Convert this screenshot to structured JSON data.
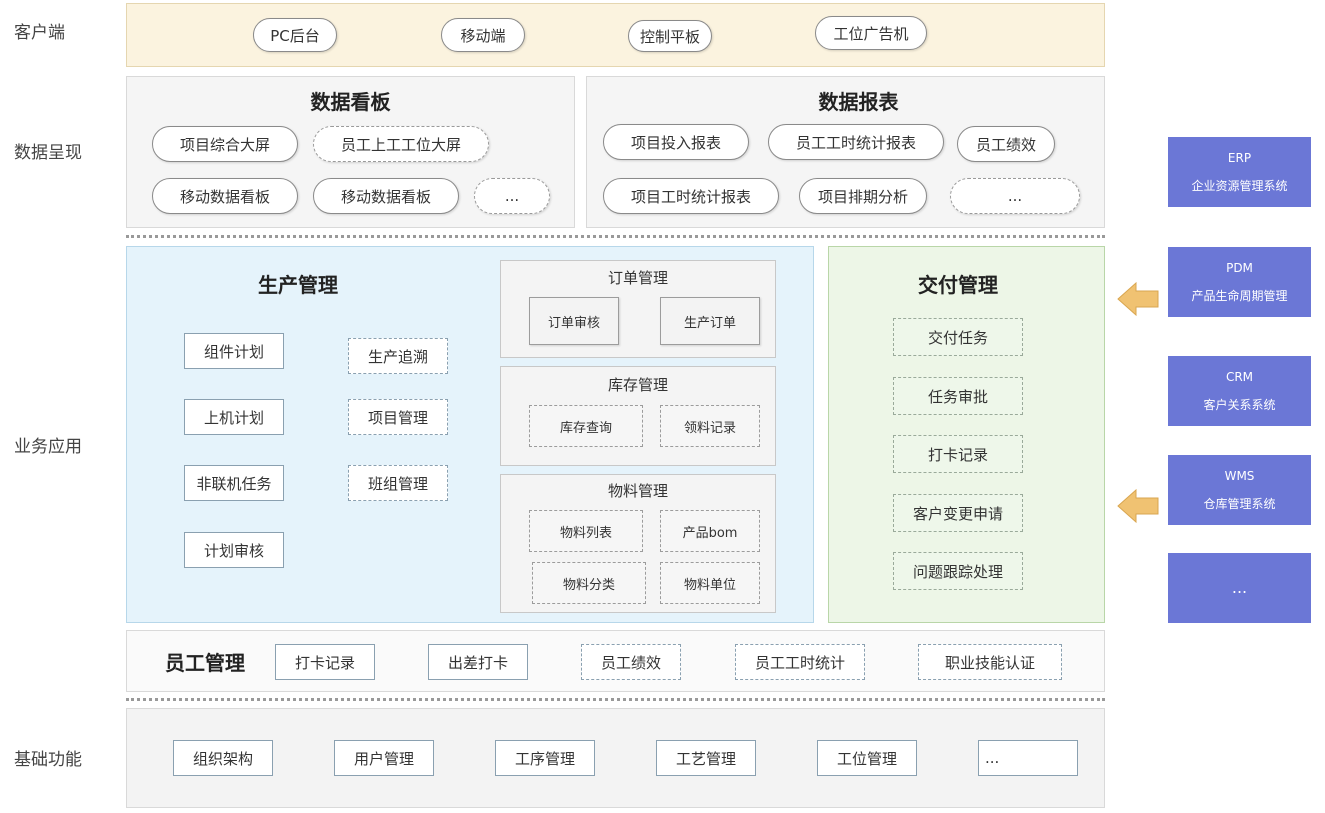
{
  "rows": {
    "client": "客户端",
    "data_display": "数据呈现",
    "business": "业务应用",
    "foundation": "基础功能"
  },
  "client_items": [
    "PC后台",
    "移动端",
    "控制平板",
    "工位广告机"
  ],
  "dashboard": {
    "title": "数据看板",
    "items": [
      "项目综合大屏",
      "员工上工工位大屏",
      "移动数据看板",
      "移动数据看板",
      "..."
    ]
  },
  "reports": {
    "title": "数据报表",
    "items": [
      "项目投入报表",
      "员工工时统计报表",
      "员工绩效",
      "项目工时统计报表",
      "项目排期分析",
      "..."
    ]
  },
  "production": {
    "title": "生产管理",
    "left": [
      "组件计划",
      "上机计划",
      "非联机任务",
      "计划审核"
    ],
    "right": [
      "生产追溯",
      "项目管理",
      "班组管理"
    ],
    "order": {
      "title": "订单管理",
      "items": [
        "订单审核",
        "生产订单"
      ]
    },
    "inventory": {
      "title": "库存管理",
      "items": [
        "库存查询",
        "领料记录"
      ]
    },
    "material": {
      "title": "物料管理",
      "items": [
        "物料列表",
        "产品bom",
        "物料分类",
        "物料单位"
      ]
    }
  },
  "delivery": {
    "title": "交付管理",
    "items": [
      "交付任务",
      "任务审批",
      "打卡记录",
      "客户变更申请",
      "问题跟踪处理"
    ]
  },
  "staff": {
    "title": "员工管理",
    "items": [
      "打卡记录",
      "出差打卡",
      "员工绩效",
      "员工工时统计",
      "职业技能认证"
    ]
  },
  "foundation_items": [
    "组织架构",
    "用户管理",
    "工序管理",
    "工艺管理",
    "工位管理",
    "..."
  ],
  "systems": [
    {
      "name": "ERP",
      "desc": "企业资源管理系统"
    },
    {
      "name": "PDM",
      "desc": "产品生命周期管理"
    },
    {
      "name": "CRM",
      "desc": "客户关系系统"
    },
    {
      "name": "WMS",
      "desc": "仓库管理系统"
    },
    {
      "name": "",
      "desc": "..."
    }
  ],
  "colors": {
    "client_bg": "#fbf3df",
    "production_bg": "#e5f3fb",
    "delivery_bg": "#edf6e7",
    "system_bg": "#6b77d6",
    "arrow": "#f0c272"
  }
}
